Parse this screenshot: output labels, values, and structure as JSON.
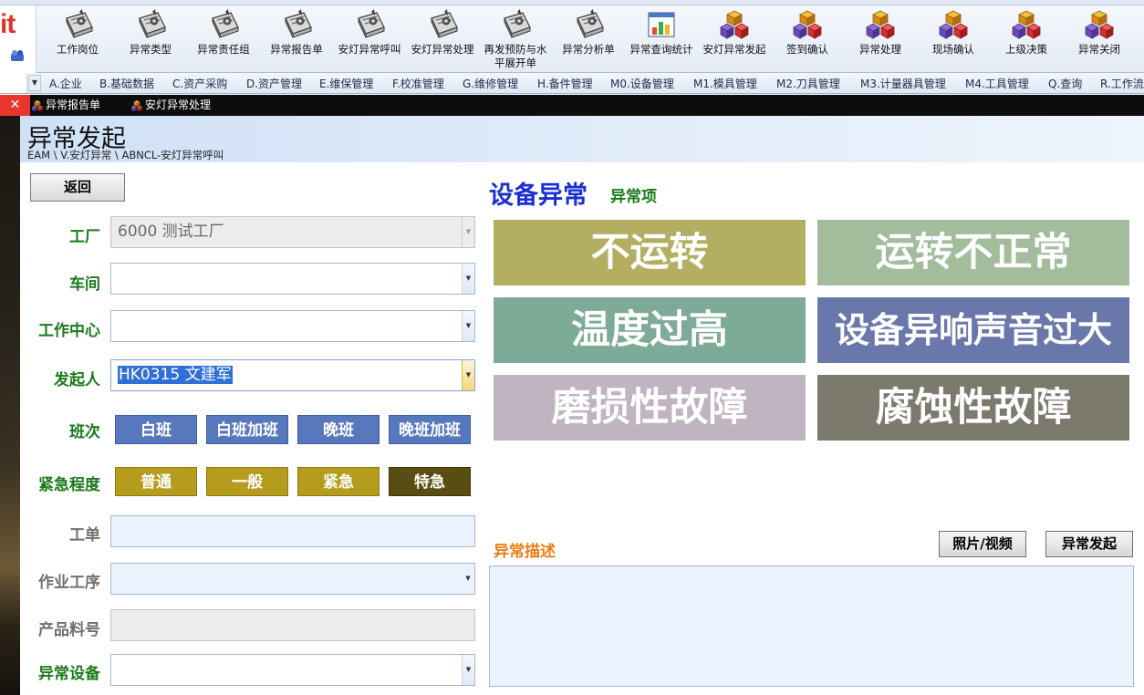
{
  "ribbon": {
    "buttons": [
      {
        "label": "工作岗位",
        "icon": "gear-document-icon"
      },
      {
        "label": "异常类型",
        "icon": "gear-document-icon"
      },
      {
        "label": "异常责任组",
        "icon": "gear-document-icon"
      },
      {
        "label": "异常报告单",
        "icon": "gear-document-icon"
      },
      {
        "label": "安灯异常呼叫",
        "icon": "gear-document-icon"
      },
      {
        "label": "安灯异常处理",
        "icon": "gear-document-icon"
      },
      {
        "label": "再发预防与水平展开单",
        "icon": "gear-document-icon"
      },
      {
        "label": "异常分析单",
        "icon": "gear-document-icon"
      },
      {
        "label": "异常查询统计",
        "icon": "chart-icon"
      },
      {
        "label": "安灯异常发起",
        "icon": "cubes-icon"
      },
      {
        "label": "签到确认",
        "icon": "cubes-icon"
      },
      {
        "label": "异常处理",
        "icon": "cubes-icon"
      },
      {
        "label": "现场确认",
        "icon": "cubes-icon"
      },
      {
        "label": "上级决策",
        "icon": "cubes-icon"
      },
      {
        "label": "异常关闭",
        "icon": "cubes-icon"
      }
    ]
  },
  "menubar": {
    "items": [
      "A.企业",
      "B.基础数据",
      "C.资产采购",
      "D.资产管理",
      "E.维保管理",
      "F.校准管理",
      "G.维修管理",
      "H.备件管理",
      "M0.设备管理",
      "M1.模具管理",
      "M2.刀具管理",
      "M3.计量器具管理",
      "M4.工具管理",
      "Q.查询",
      "R.工作流"
    ]
  },
  "tabs": [
    {
      "label": "异常报告单"
    },
    {
      "label": "安灯异常处理"
    }
  ],
  "header": {
    "title": "异常发起",
    "breadcrumb": "EAM \\ V.安灯异常 \\ ABNCL-安灯异常呼叫"
  },
  "form": {
    "back_label": "返回",
    "fields": {
      "factory": {
        "label": "工厂",
        "value": "6000 测试工厂"
      },
      "workshop": {
        "label": "车间",
        "value": ""
      },
      "work_center": {
        "label": "工作中心",
        "value": ""
      },
      "initiator": {
        "label": "发起人",
        "value": "HK0315 文建军"
      },
      "work_order": {
        "label": "工单",
        "value": ""
      },
      "operation": {
        "label": "作业工序",
        "value": ""
      },
      "product_no": {
        "label": "产品料号",
        "value": ""
      },
      "equipment": {
        "label": "异常设备",
        "value": ""
      }
    },
    "shift": {
      "label": "班次",
      "options": [
        "白班",
        "白班加班",
        "晚班",
        "晚班加班"
      ]
    },
    "urgency": {
      "label": "紧急程度",
      "options": [
        "普通",
        "一般",
        "紧急",
        "特急"
      ]
    }
  },
  "anomaly": {
    "title": "设备异常",
    "subtitle": "异常项",
    "items": [
      {
        "label": "不运转",
        "color": "#b3ae62"
      },
      {
        "label": "运转不正常",
        "color": "#a2bc9c"
      },
      {
        "label": "温度过高",
        "color": "#7eaa98"
      },
      {
        "label": "设备异响声音过大",
        "color": "#6a77aa"
      },
      {
        "label": "磨损性故障",
        "color": "#bfb4bf"
      },
      {
        "label": "腐蚀性故障",
        "color": "#7b7a6c"
      }
    ],
    "description_label": "异常描述",
    "media_label": "照片/视频",
    "submit_label": "异常发起"
  },
  "colors": {
    "label_green": "#1a7a1a",
    "title_blue": "#1c2fd4",
    "desc_orange": "#ee7d14",
    "shift_blue": "#5878bd",
    "urgency_gold": "#b69c1d",
    "urgency_dark": "#5a4d13"
  }
}
